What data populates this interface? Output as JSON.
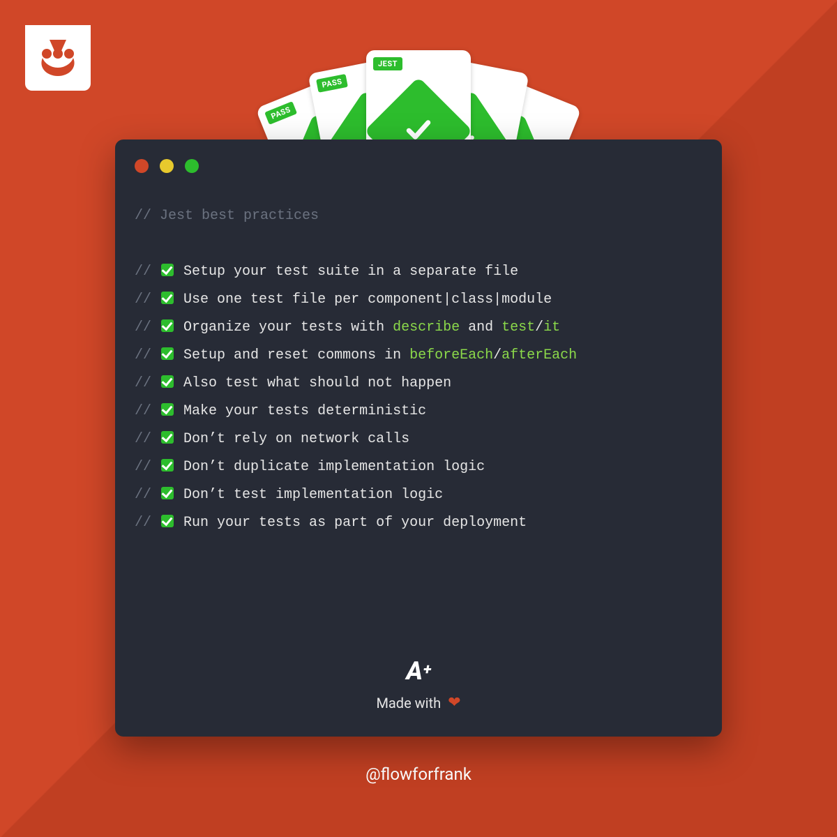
{
  "cards": {
    "badges": {
      "pass": "PASS",
      "jest": "JEST"
    }
  },
  "code": {
    "title_comment": "// Jest best practices",
    "tips": [
      {
        "segments": [
          {
            "t": "Setup your test suite in a separate file"
          }
        ]
      },
      {
        "segments": [
          {
            "t": "Use one test file per component|class|module"
          }
        ]
      },
      {
        "segments": [
          {
            "t": "Organize your tests with "
          },
          {
            "t": "describe",
            "kw": true
          },
          {
            "t": " and "
          },
          {
            "t": "test",
            "kw": true
          },
          {
            "t": "/"
          },
          {
            "t": "it",
            "kw": true
          }
        ]
      },
      {
        "segments": [
          {
            "t": "Setup and reset commons in "
          },
          {
            "t": "beforeEach",
            "kw": true
          },
          {
            "t": "/"
          },
          {
            "t": "afterEach",
            "kw": true
          }
        ]
      },
      {
        "segments": [
          {
            "t": "Also test what should not happen"
          }
        ]
      },
      {
        "segments": [
          {
            "t": "Make your tests deterministic"
          }
        ]
      },
      {
        "segments": [
          {
            "t": "Don’t rely on network calls"
          }
        ]
      },
      {
        "segments": [
          {
            "t": "Don’t duplicate implementation logic"
          }
        ]
      },
      {
        "segments": [
          {
            "t": "Don’t test implementation logic"
          }
        ]
      },
      {
        "segments": [
          {
            "t": "Run your tests as part of your deployment"
          }
        ]
      }
    ]
  },
  "footer": {
    "logo_text": "A",
    "logo_plus": "+",
    "made_with": "Made with"
  },
  "handle": "@flowforfrank"
}
